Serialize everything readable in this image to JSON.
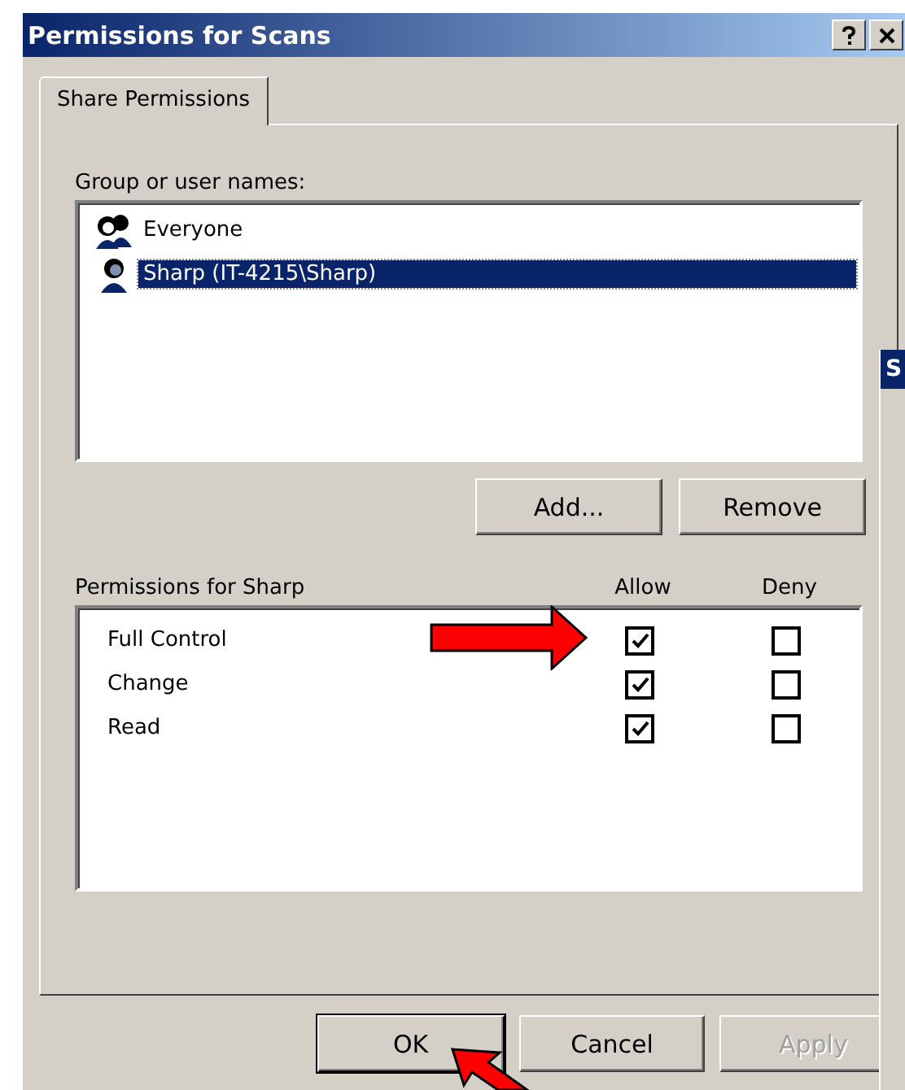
{
  "window": {
    "title": "Permissions for Scans"
  },
  "tabs": [
    {
      "label": "Share Permissions",
      "selected": true
    }
  ],
  "group_list": {
    "label": "Group or user names:",
    "items": [
      {
        "name": "Everyone",
        "kind": "group",
        "selected": false
      },
      {
        "name": "Sharp (IT-4215\\Sharp)",
        "kind": "user",
        "selected": true
      }
    ]
  },
  "list_buttons": [
    {
      "label": "Add...",
      "disabled": false
    },
    {
      "label": "Remove",
      "disabled": false
    }
  ],
  "permissions": {
    "label": "Permissions for Sharp",
    "columns": [
      "Allow",
      "Deny"
    ],
    "rows": [
      {
        "name": "Full Control",
        "allow": true,
        "deny": false
      },
      {
        "name": "Change",
        "allow": true,
        "deny": false
      },
      {
        "name": "Read",
        "allow": true,
        "deny": false
      }
    ]
  },
  "buttons": [
    {
      "label": "OK",
      "default": true,
      "disabled": false
    },
    {
      "label": "Cancel",
      "default": false,
      "disabled": false
    },
    {
      "label": "Apply",
      "default": false,
      "disabled": true
    }
  ],
  "background_window": {
    "title": "S"
  }
}
